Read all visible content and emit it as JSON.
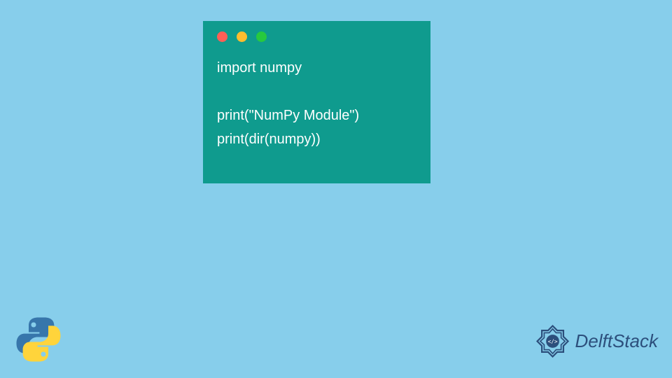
{
  "code": {
    "line1": "import numpy",
    "line2": "print(\"NumPy Module\")",
    "line3": "print(dir(numpy))"
  },
  "branding": {
    "text": "DelftStack"
  },
  "window_controls": {
    "red": "close",
    "yellow": "minimize",
    "green": "maximize"
  }
}
